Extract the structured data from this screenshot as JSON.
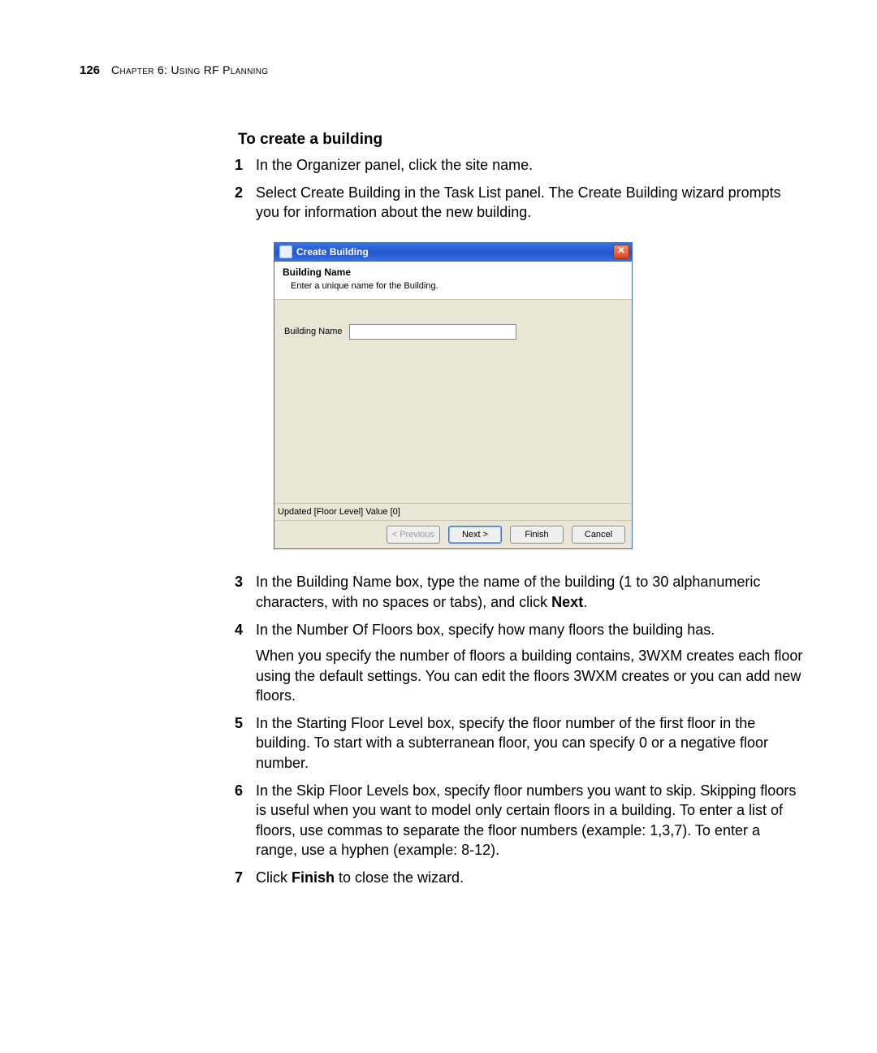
{
  "header": {
    "page_number": "126",
    "chapter_label": "Chapter 6: Using RF Planning"
  },
  "section_title": "To create a building",
  "steps": {
    "s1": {
      "num": "1",
      "text": "In the Organizer panel, click the site name."
    },
    "s2": {
      "num": "2",
      "text": "Select Create Building in the Task List panel. The Create Building wizard prompts you for information about the new building."
    },
    "s3": {
      "num": "3",
      "text_a": "In the Building Name box, type the name of the building (1 to 30 alphanumeric characters, with no spaces or tabs), and click ",
      "bold": "Next",
      "text_b": "."
    },
    "s4": {
      "num": "4",
      "text": "In the Number Of Floors box, specify how many floors the building has.",
      "para": "When you specify the number of floors a building contains, 3WXM creates each floor using the default settings. You can edit the floors 3WXM creates or you can add new floors."
    },
    "s5": {
      "num": "5",
      "text": "In the Starting Floor Level box, specify the floor number of the first floor in the building. To start with a subterranean floor, you can specify 0 or a negative floor number."
    },
    "s6": {
      "num": "6",
      "text": "In the Skip Floor Levels box, specify floor numbers you want to skip. Skipping floors is useful when you want to model only certain floors in a building. To enter a list of floors, use commas to separate the floor numbers (example: 1,3,7). To enter a range, use a hyphen (example: 8-12)."
    },
    "s7": {
      "num": "7",
      "text_a": "Click ",
      "bold": "Finish",
      "text_b": " to close the wizard."
    }
  },
  "wizard": {
    "title": "Create Building",
    "close_glyph": "✕",
    "header_title": "Building Name",
    "header_sub": "Enter a unique name for the Building.",
    "field_label": "Building Name",
    "field_value": "",
    "status": "Updated [Floor Level] Value [0]",
    "buttons": {
      "previous": "< Previous",
      "next": "Next >",
      "finish": "Finish",
      "cancel": "Cancel"
    }
  }
}
